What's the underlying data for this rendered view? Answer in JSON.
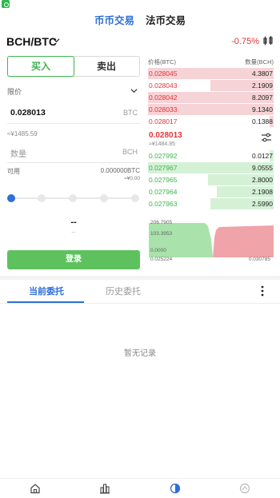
{
  "top_tabs": [
    {
      "label": "币币交易",
      "active": true
    },
    {
      "label": "法币交易",
      "active": false
    }
  ],
  "pair": {
    "title": "BCH/BTC",
    "change": "-0.75%"
  },
  "side_tabs": {
    "buy": "买入",
    "sell": "卖出"
  },
  "order_form": {
    "order_type": "限价",
    "price_value": "0.028013",
    "price_unit": "BTC",
    "price_approx": "≈¥1485.59",
    "amount_placeholder": "数量",
    "amount_unit": "BCH",
    "available_label": "可用",
    "available_value": "0.000000BTC",
    "available_sub": "≈¥0.00",
    "total_value": "--",
    "total_sub": "--",
    "submit_label": "登录"
  },
  "order_book": {
    "price_header": "价格(BTC)",
    "qty_header": "数量(BCH)",
    "asks": [
      {
        "price": "0.028045",
        "qty": "4.3807",
        "depth": 1.0
      },
      {
        "price": "0.028043",
        "qty": "2.1909",
        "depth": 0.5
      },
      {
        "price": "0.028042",
        "qty": "8.2097",
        "depth": 1.0
      },
      {
        "price": "0.028033",
        "qty": "9.1340",
        "depth": 1.0
      },
      {
        "price": "0.028017",
        "qty": "0.1388",
        "depth": 0.03
      }
    ],
    "mid_price": "0.028013",
    "mid_sub": "≈¥1484.85",
    "bids": [
      {
        "price": "0.027992",
        "qty": "0.0127",
        "depth": 0.03
      },
      {
        "price": "0.027967",
        "qty": "9.0555",
        "depth": 1.0
      },
      {
        "price": "0.027965",
        "qty": "2.8000",
        "depth": 0.52
      },
      {
        "price": "0.027964",
        "qty": "2.1908",
        "depth": 0.45
      },
      {
        "price": "0.027963",
        "qty": "2.5990",
        "depth": 0.5
      }
    ]
  },
  "depth_chart": {
    "y_top": "206.7905",
    "y_mid": "103.3953",
    "y_bottom": "0.0000",
    "x_left": "0.025224",
    "x_right": "0.030785",
    "bid_color": "#a9e2ab",
    "ask_color": "#f0a3a8"
  },
  "order_tabs": [
    {
      "label": "当前委托",
      "active": true
    },
    {
      "label": "历史委托",
      "active": false
    }
  ],
  "empty_text": "暂无记录",
  "bottom_nav": [
    "home-icon",
    "market-icon",
    "trade-icon",
    "assets-icon"
  ],
  "colors": {
    "accent": "#2e6fd8",
    "up": "#3fb34f",
    "down": "#e5343a"
  }
}
